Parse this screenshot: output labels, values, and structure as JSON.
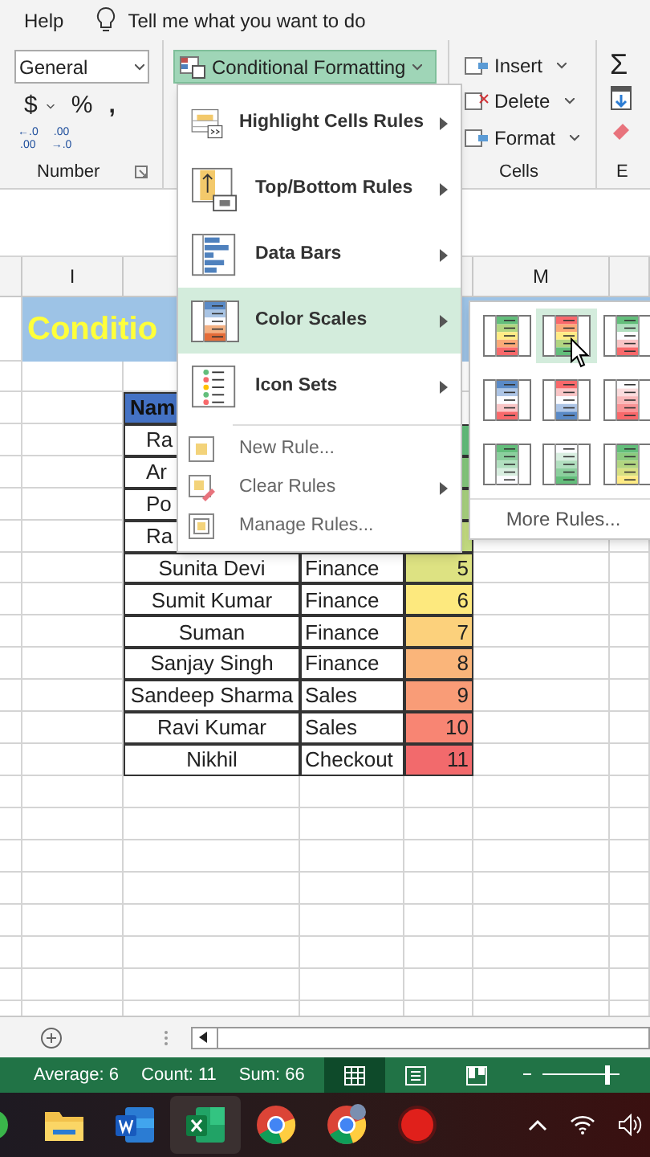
{
  "ribbon": {
    "help": "Help",
    "tell_me": "Tell me what you want to do",
    "number_format": "General",
    "currency": "$",
    "percent": "%",
    "comma": ",",
    "decimal_buttons": [
      {
        "top": "←.0",
        "bottom": ".00"
      },
      {
        "top": ".00",
        "bottom": "→.0"
      }
    ],
    "number_label": "Number",
    "conditional_formatting": {
      "label": "Conditional Formatting",
      "expanded": true
    },
    "cells": [
      "Insert",
      "Delete",
      "Format"
    ],
    "cells_label": "Cells",
    "autosum": "Σ",
    "editing_label": "E"
  },
  "columns": [
    "",
    "I",
    "",
    "",
    "",
    "M",
    ""
  ],
  "sheet": {
    "title": "Conditio",
    "header": "Nam",
    "rows": [
      {
        "name": "Ra",
        "color": "#63be7b"
      },
      {
        "name": "Ar",
        "color": "#85c87d"
      },
      {
        "name": "Po",
        "color": "#a8d27f"
      },
      {
        "name": "Ra",
        "color": "#c4dc80"
      },
      {
        "name": "Sunita Devi",
        "dept": "Finance",
        "value": "5",
        "color": "#dde282"
      },
      {
        "name": "Sumit Kumar",
        "dept": "Finance",
        "value": "6",
        "color": "#fde97e"
      },
      {
        "name": "Suman",
        "dept": "Finance",
        "value": "7",
        "color": "#fcd17c"
      },
      {
        "name": "Sanjay Singh",
        "dept": "Finance",
        "value": "8",
        "color": "#fab57a"
      },
      {
        "name": "Sandeep Sharma",
        "dept": "Sales",
        "value": "9",
        "color": "#f99c77"
      },
      {
        "name": "Ravi Kumar",
        "dept": "Sales",
        "value": "10",
        "color": "#f88573"
      },
      {
        "name": "Nikhil",
        "dept": "Checkout",
        "value": "11",
        "color": "#f26a6c"
      }
    ]
  },
  "menu": [
    {
      "kind": "large",
      "label": "Highlight Cells Rules",
      "submenu": true,
      "selected": false
    },
    {
      "kind": "large",
      "label": "Top/Bottom Rules",
      "submenu": true,
      "selected": false
    },
    {
      "kind": "large",
      "label": "Data Bars",
      "submenu": true,
      "selected": false
    },
    {
      "kind": "large",
      "label": "Color Scales",
      "submenu": true,
      "selected": true
    },
    {
      "kind": "large",
      "label": "Icon Sets",
      "submenu": true,
      "selected": false
    },
    {
      "kind": "small",
      "label": "New Rule...",
      "submenu": false,
      "selected": false
    },
    {
      "kind": "small",
      "label": "Clear Rules",
      "submenu": true,
      "selected": false
    },
    {
      "kind": "small",
      "label": "Manage Rules...",
      "submenu": false,
      "selected": false
    }
  ],
  "color_scales": [
    {
      "selected": false
    },
    {
      "selected": true
    },
    {
      "selected": false
    },
    {
      "selected": false
    },
    {
      "selected": false
    },
    {
      "selected": false
    },
    {
      "selected": false
    },
    {
      "selected": false
    },
    {
      "selected": false
    }
  ],
  "more_rules": "More Rules...",
  "status": {
    "items": [
      "Average: 6",
      "Count: 11",
      "Sum: 66"
    ],
    "views": [
      {
        "kind": "normal",
        "selected": true
      },
      {
        "kind": "layout",
        "selected": false
      },
      {
        "kind": "pagebreak",
        "selected": false
      }
    ],
    "zoom": {
      "level": 0.88
    }
  },
  "taskbar": [
    {
      "kind": "partial",
      "selected": false
    },
    {
      "kind": "folder",
      "selected": false
    },
    {
      "kind": "word",
      "selected": false
    },
    {
      "kind": "excel",
      "selected": true
    },
    {
      "kind": "chrome",
      "selected": false
    },
    {
      "kind": "chrome2",
      "selected": false
    },
    {
      "kind": "record",
      "selected": false
    }
  ]
}
